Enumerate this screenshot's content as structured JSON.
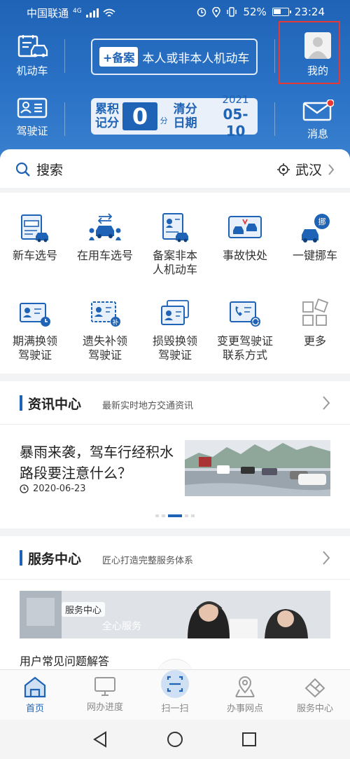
{
  "status_bar": {
    "carrier": "中国联通",
    "network": "4G",
    "battery": "52%",
    "time": "23:24"
  },
  "header": {
    "vehicle_label": "机动车",
    "license_label": "驾驶证",
    "register": {
      "tag": "+备案",
      "text": "本人或非本人机动车"
    },
    "score": {
      "label": "累积记分",
      "value": "0",
      "unit": "分",
      "clear_label": "清分日期",
      "year": "2021",
      "date": "05-10"
    },
    "my_label": "我的",
    "message_label": "消息"
  },
  "search": {
    "label": "搜索",
    "city": "武汉"
  },
  "services": [
    {
      "label": "新车选号"
    },
    {
      "label": "在用车选号"
    },
    {
      "label": "备案非本\n人机动车"
    },
    {
      "label": "事故快处"
    },
    {
      "label": "一键挪车"
    },
    {
      "label": "期满换领\n驾驶证"
    },
    {
      "label": "遗失补领\n驾驶证"
    },
    {
      "label": "损毁换领\n驾驶证"
    },
    {
      "label": "变更驾驶证\n联系方式"
    },
    {
      "label": "更多"
    }
  ],
  "news_center": {
    "title": "资讯中心",
    "subtitle": "最新实时地方交通资讯",
    "article": {
      "title": "暴雨来袭，驾车行经积水路段要注意什么？",
      "date": "2020-06-23"
    }
  },
  "service_center": {
    "title": "服务中心",
    "subtitle": "匠心打造完整服务体系",
    "banner_tag": "服务中心",
    "banner_text": "全心服务",
    "faq": "用户常见问题解答"
  },
  "tabs": [
    {
      "label": "首页",
      "active": true
    },
    {
      "label": "网办进度",
      "active": false
    },
    {
      "label": "扫一扫",
      "active": false
    },
    {
      "label": "办事网点",
      "active": false
    },
    {
      "label": "服务中心",
      "active": false
    }
  ],
  "colors": {
    "primary": "#1f63b6",
    "highlight": "#e53935"
  }
}
